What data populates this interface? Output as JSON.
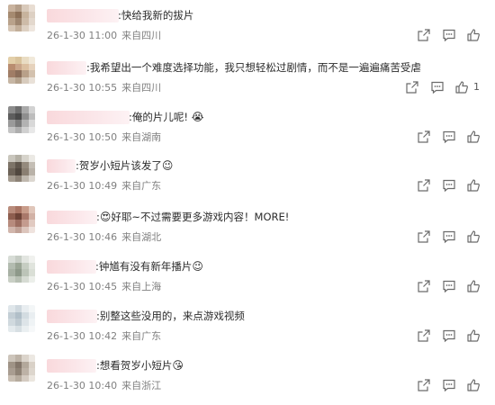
{
  "comments": [
    {
      "text": ":快给我新的拔片",
      "date": "26-1-30 11:00",
      "location": "来自四川",
      "emoji": "",
      "likes": ""
    },
    {
      "text": ":我希望出一个难度选择功能，我只想轻松过剧情，而不是一遍遍痛苦受虐",
      "date": "26-1-30 10:55",
      "location": "来自四川",
      "emoji": "",
      "likes": "1"
    },
    {
      "text": ":俺的片儿呢!",
      "date": "26-1-30 10:50",
      "location": "来自湖南",
      "emoji": "😭",
      "likes": ""
    },
    {
      "text": ":贺岁小短片该发了",
      "date": "26-1-30 10:49",
      "location": "来自广东",
      "emoji": "😉",
      "likes": ""
    },
    {
      "text": ":",
      "date": "26-1-30 10:46",
      "location": "来自湖北",
      "emoji": "😍",
      "text_after": "好耶~不过需要更多游戏内容！MORE!",
      "likes": ""
    },
    {
      "text": ":钟馗有没有新年播片",
      "date": "26-1-30 10:45",
      "location": "来自上海",
      "emoji": "😉",
      "likes": ""
    },
    {
      "text": ":别整这些没用的，来点游戏视频",
      "date": "26-1-30 10:42",
      "location": "来自广东",
      "emoji": "",
      "likes": ""
    },
    {
      "text": ":想看贺岁小短片",
      "date": "26-1-30 10:40",
      "location": "来自浙江",
      "emoji": "😘",
      "likes": ""
    }
  ],
  "icons": {
    "share": "share-icon",
    "comment": "comment-icon",
    "like": "like-icon"
  },
  "colors": {
    "meta_text": "#808080",
    "icon": "#6b6b6b",
    "name_blur": "#f9d9dc"
  }
}
